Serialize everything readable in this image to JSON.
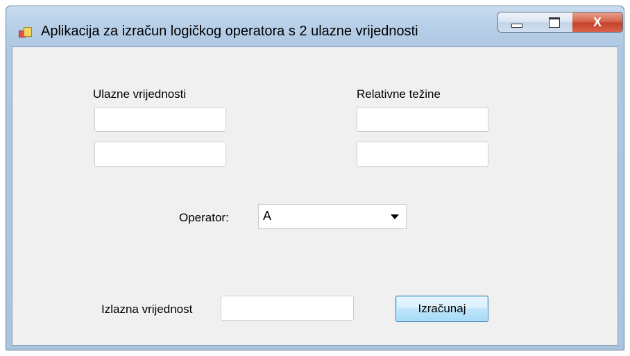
{
  "window": {
    "title": "Aplikacija za izračun logičkog operatora s 2 ulazne vrijednosti",
    "controls": {
      "minimize_icon": "minimize-icon",
      "maximize_icon": "maximize-icon",
      "close_glyph": "X"
    }
  },
  "inputs": {
    "label": "Ulazne vrijednosti",
    "field1_value": "",
    "field2_value": ""
  },
  "weights": {
    "label": "Relativne težine",
    "field1_value": "",
    "field2_value": ""
  },
  "operator": {
    "label": "Operator:",
    "selected": "A"
  },
  "output": {
    "label": "Izlazna vrijednost",
    "value": ""
  },
  "actions": {
    "calculate_label": "Izračunaj"
  }
}
